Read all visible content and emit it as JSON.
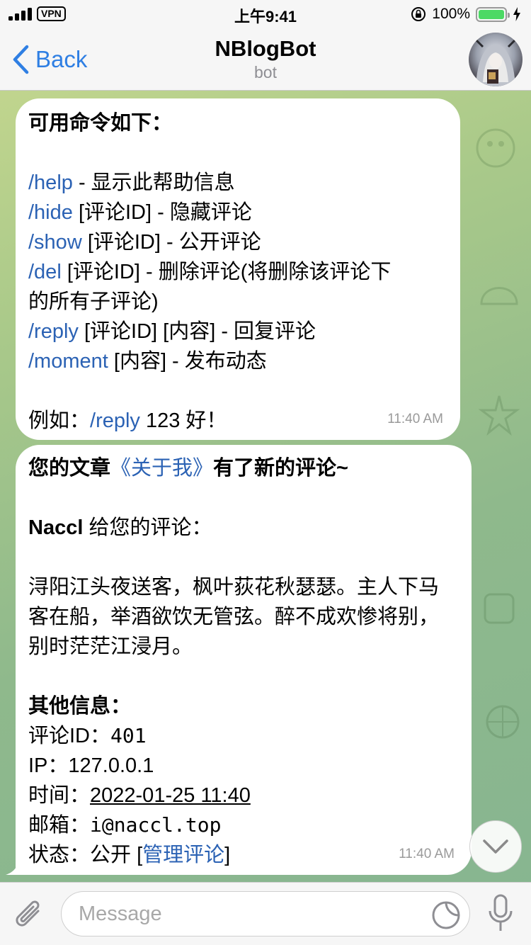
{
  "status_bar": {
    "vpn": "VPN",
    "time": "上午9:41",
    "battery_pct": "100%"
  },
  "nav": {
    "back_label": "Back",
    "title": "NBlogBot",
    "subtitle": "bot"
  },
  "messages": [
    {
      "header": "可用命令如下：",
      "commands": [
        {
          "cmd": "/help",
          "desc": " - 显示此帮助信息"
        },
        {
          "cmd": "/hide",
          "desc": " [评论ID] - 隐藏评论"
        },
        {
          "cmd": "/show",
          "desc": " [评论ID] - 公开评论"
        },
        {
          "cmd": "/del",
          "desc": " [评论ID] - 删除评论(将删除该评论下"
        },
        {
          "cmd": "",
          "desc": "的所有子评论)"
        },
        {
          "cmd": "/reply",
          "desc": " [评论ID] [内容] - 回复评论"
        },
        {
          "cmd": "/moment",
          "desc": " [内容] - 发布动态"
        }
      ],
      "example_prefix": "例如：",
      "example_cmd": "/reply",
      "example_rest": " 123 好！",
      "time": "11:40 AM"
    },
    {
      "line1_pre": "您的文章",
      "article_link": "《关于我》",
      "line1_post": "有了新的评论~",
      "author": "Naccl",
      "author_suffix": " 给您的评论：",
      "comment_lines": [
        "浔阳江头夜送客，枫叶荻花秋瑟瑟。主人下马",
        "客在船，举酒欲饮无管弦。醉不成欢惨将别，",
        "别时茫茫江浸月。"
      ],
      "other_title": "其他信息：",
      "comment_id_label": "评论ID：",
      "comment_id": "401",
      "ip_label": "IP：",
      "ip": "127.0.0.1",
      "time_label": "时间：",
      "time_value": "2022-01-25 11:40",
      "email_label": "邮箱：",
      "email": "i@naccl.top",
      "status_label": "状态：",
      "status_value": "公开 [",
      "manage_link": "管理评论",
      "status_close": "]",
      "time": "11:40 AM"
    }
  ],
  "input": {
    "placeholder": "Message"
  },
  "colors": {
    "accent": "#2f7fe3",
    "link": "#2b62b4",
    "battery": "#4cd964"
  }
}
